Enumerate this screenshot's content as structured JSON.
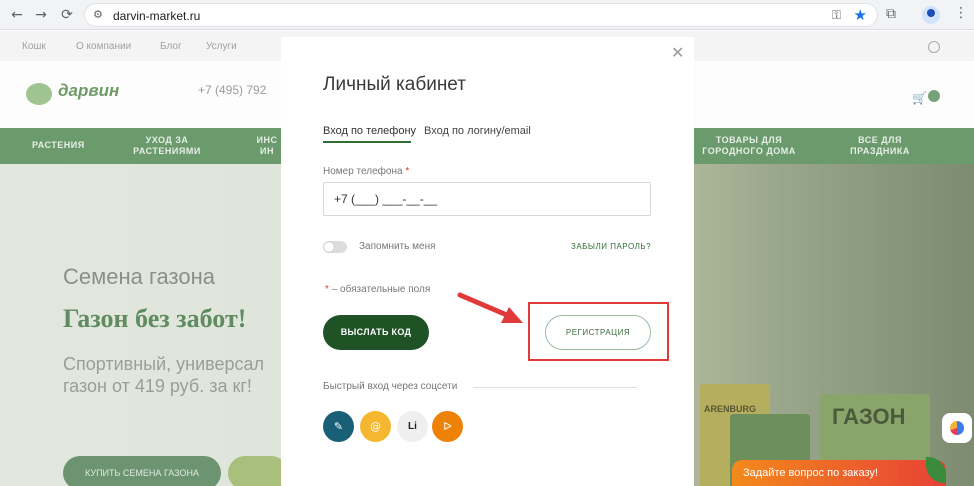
{
  "browser": {
    "url": "darvin-market.ru",
    "back_icon": "←",
    "forward_icon": "→",
    "reload_icon": "⟳"
  },
  "site": {
    "logo": "дарвин",
    "phone": "+7 (495) 792",
    "categories": [
      "РАСТЕНИЯ",
      "УХОД ЗА РАСТЕНИЯМИ",
      "ИНС ИН",
      "ТОВАРЫ ДЛЯ ГОРОДНОГО ДОМА",
      "ВСЕ ДЛЯ ПРАЗДНИКА"
    ],
    "hero": {
      "title": "Семена газона",
      "headline": "Газон без забот!",
      "sub1": "Спортивный, универсал",
      "sub2": "газон от 419 руб. за кг!",
      "cta": "КУПИТЬ СЕМЕНА ГАЗОНА"
    },
    "product_labels": [
      "ARENBURG",
      "ГАЗОН"
    ],
    "ask_widget": "Задайте вопрос по заказу!"
  },
  "modal": {
    "title": "Личный кабинет",
    "tabs": [
      {
        "label": "Вход по телефону",
        "active": true
      },
      {
        "label": "Вход по логину/email",
        "active": false
      }
    ],
    "phone_label": "Номер телефона",
    "required_mark": "*",
    "phone_value": "+7 (___) ___-__-__",
    "remember_label": "Запомнить меня",
    "forgot_link": "ЗАБЫЛИ ПАРОЛЬ?",
    "required_note": "– обязательные поля",
    "send_button": "ВЫСЛАТЬ КОД",
    "register_button": "РЕГИСТРАЦИЯ",
    "social_label": "Быстрый вход через соцсети",
    "social": [
      {
        "name": "vk",
        "glyph": "✎"
      },
      {
        "name": "mail",
        "glyph": "@"
      },
      {
        "name": "linkedin",
        "glyph": "Li"
      },
      {
        "name": "ok",
        "glyph": "ᐅ"
      }
    ],
    "close_glyph": "✕"
  },
  "annotation": {
    "color": "#e0393a"
  }
}
